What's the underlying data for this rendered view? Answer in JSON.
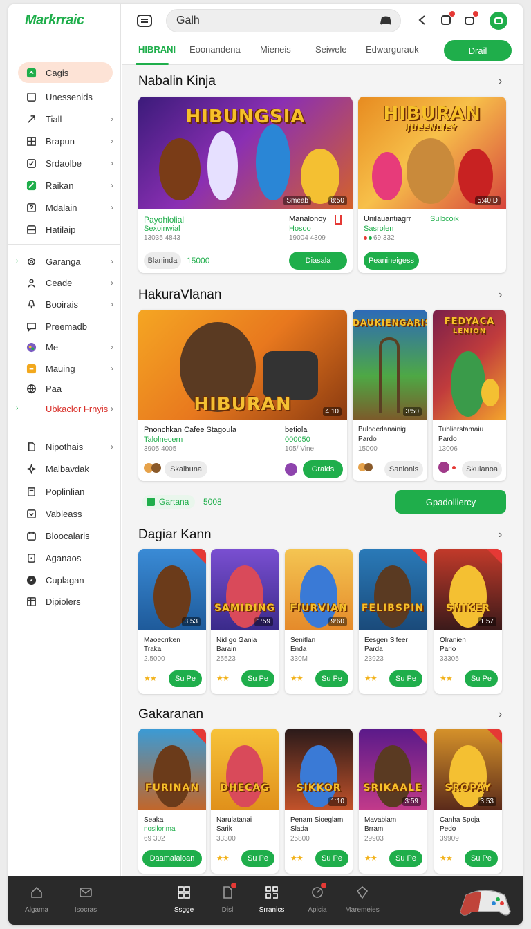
{
  "app": {
    "logo": "Markrraic"
  },
  "sidebar": {
    "items": [
      {
        "label": "Cagis",
        "icon": "green-square-icon",
        "active": true
      },
      {
        "label": "Unessenids",
        "icon": "square-outline-icon"
      },
      {
        "label": "Tiall",
        "icon": "arrow-icon",
        "chev": true
      },
      {
        "label": "Brapun",
        "icon": "grid-icon",
        "chev": true
      },
      {
        "label": "Srdaolbe",
        "icon": "checkbox-icon",
        "chev": true
      },
      {
        "label": "Raikan",
        "icon": "green-edit-icon",
        "chev": true
      },
      {
        "label": "Mdalain",
        "icon": "question-box-icon",
        "chev": true
      },
      {
        "label": "Hatilaip",
        "icon": "list-box-icon"
      },
      {
        "label": "Garanga",
        "icon": "gear-icon",
        "chev": true,
        "arrow": true
      },
      {
        "label": "Ceade",
        "icon": "person-icon",
        "chev": true
      },
      {
        "label": "Booirais",
        "icon": "lamp-icon",
        "chev": true
      },
      {
        "label": "Preemadb",
        "icon": "chat-icon"
      },
      {
        "label": "Me",
        "icon": "avatar-icon",
        "chev": true
      },
      {
        "label": "Mauing",
        "icon": "orange-box-icon",
        "chev": true
      },
      {
        "label": "Paa",
        "icon": "globe-icon"
      },
      {
        "label": "Ubkaclor Frnyis",
        "icon": "none",
        "chev": true,
        "arrow": true,
        "red": true
      },
      {
        "label": "Nipothais",
        "icon": "doc-icon",
        "chev": true
      },
      {
        "label": "Malbavdak",
        "icon": "sparkle-icon"
      },
      {
        "label": "Poplinlian",
        "icon": "page-icon"
      },
      {
        "label": "Vableass",
        "icon": "download-box-icon"
      },
      {
        "label": "Bloocalaris",
        "icon": "calendar-icon"
      },
      {
        "label": "Aganaos",
        "icon": "dot-box-icon"
      },
      {
        "label": "Cuplagan",
        "icon": "compass-icon"
      },
      {
        "label": "Dipiolers",
        "icon": "table-icon"
      }
    ]
  },
  "topbar": {
    "search_value": "Galh",
    "tabs": [
      "HIBRANI",
      "Eoonandena",
      "Mieneis",
      "Seiwele",
      "Edwargurauk"
    ],
    "tab_button": "Drail"
  },
  "sections": {
    "s1": {
      "title": "Nabalin Kinja",
      "cards": [
        {
          "art_title": "HIBUNGSIA",
          "tag": "Smeab",
          "tag2": "8:50",
          "line1": "Payohlolial",
          "line2": "Sexoinwial",
          "line3": "13035 4843",
          "mid1": "Manalonoy",
          "mid2": "Hosoo",
          "mid3": "19004 4309",
          "pill": "Blaninda",
          "value": "15000",
          "button": "Diasala"
        },
        {
          "art_title": "HIBURAN",
          "art_sub": "JUEENLIEY",
          "tag": "5:40 D",
          "line1": "Unilauantiagrr",
          "line1b": "Sulbcoik",
          "line2": "Sasrolen",
          "line3": "69 332",
          "button": "Peanineigess"
        }
      ]
    },
    "s2": {
      "title": "HakuraVlanan",
      "cards": [
        {
          "art_title": "HIBURAN",
          "tag": "4:10",
          "line1": "Pnonchkan Cafee Stagoula",
          "line2": "Talolnecern",
          "line3": "3905 4005",
          "mid1": "betiola",
          "mid2": "000050",
          "mid3": "105/ Vine",
          "pill": "Skalbuna",
          "button": "Gralds"
        },
        {
          "art_title": "DAUKIENGARIS",
          "tag": "3:50",
          "line1": "Bulodedanainig",
          "line2": "Pardo",
          "line3": "15000",
          "pill": "Sanionls"
        },
        {
          "art_title": "FEDYACA",
          "art_sub": "LENION",
          "line1": "Tublierstamaiu",
          "line2": "Pardo",
          "line3": "13006",
          "pill": "Skulanoa"
        }
      ],
      "chip_label": "Gartana",
      "chip_value": "5008",
      "wide_button": "Gpadolliercy"
    },
    "s3": {
      "title": "Dagiar Kann",
      "cards": [
        {
          "art_title": "",
          "tag": "3:53",
          "line1": "Maoecrrken",
          "line2": "Traka",
          "line3": "2.5000",
          "button": "Su Pe"
        },
        {
          "art_title": "SAMIDING",
          "tag": "1:59",
          "line1": "Nid go Gania",
          "line2": "Barain",
          "line3": "25523",
          "button": "Su Pe"
        },
        {
          "art_title": "FIURVIAN",
          "tag": "9:60",
          "line1": "Senitlan",
          "line2": "Enda",
          "line3": "330M",
          "button": "Su Pe"
        },
        {
          "art_title": "FELIBSPIN",
          "line1": "Eesgen Slfeer",
          "line2": "Parda",
          "line3": "23923",
          "button": "Su Pe"
        },
        {
          "art_title": "SNIKER",
          "tag": "1:57",
          "line1": "Olranien",
          "line2": "Parlo",
          "line3": "33305",
          "button": "Su Pe"
        }
      ]
    },
    "s4": {
      "title": "Gakaranan",
      "cards": [
        {
          "art_title": "FURINAN",
          "line1": "Seaka",
          "line2": "nosilorima",
          "line3": "69 302",
          "button": "Daamalaloan"
        },
        {
          "art_title": "DHECAG",
          "line1": "Narulatanai",
          "line2": "Sarik",
          "line3": "33300",
          "button": "Su Pe"
        },
        {
          "art_title": "SIKKOR",
          "tag": "1:10",
          "line1": "Penam Sioeglam",
          "line2": "Slada",
          "line3": "25800",
          "button": "Su Pe"
        },
        {
          "art_title": "SRIKAALE",
          "tag": "3:59",
          "line1": "Mavabiam",
          "line2": "Brram",
          "line3": "29903",
          "button": "Su Pe"
        },
        {
          "art_title": "SROPAY",
          "tag": "3:53",
          "line1": "Canha Spoja",
          "line2": "Pedo",
          "line3": "39909",
          "button": "Su Pe"
        }
      ]
    }
  },
  "bottombar": {
    "items": [
      {
        "label": "Algama",
        "icon": "home-icon"
      },
      {
        "label": "Isocras",
        "icon": "mail-icon"
      },
      {
        "label": "Ssgge",
        "icon": "grid-icon",
        "on": true
      },
      {
        "label": "Disl",
        "icon": "doc-icon",
        "dot": true
      },
      {
        "label": "Srranics",
        "icon": "qr-icon",
        "on": true
      },
      {
        "label": "Apicia",
        "icon": "gauge-icon",
        "dot": true
      },
      {
        "label": "Maremeies",
        "icon": "gem-icon"
      }
    ]
  },
  "colors": {
    "accent": "#1fae4b",
    "active_bg": "#fde3d6",
    "alert": "#e53935",
    "bottombar": "#2a2a2a"
  }
}
